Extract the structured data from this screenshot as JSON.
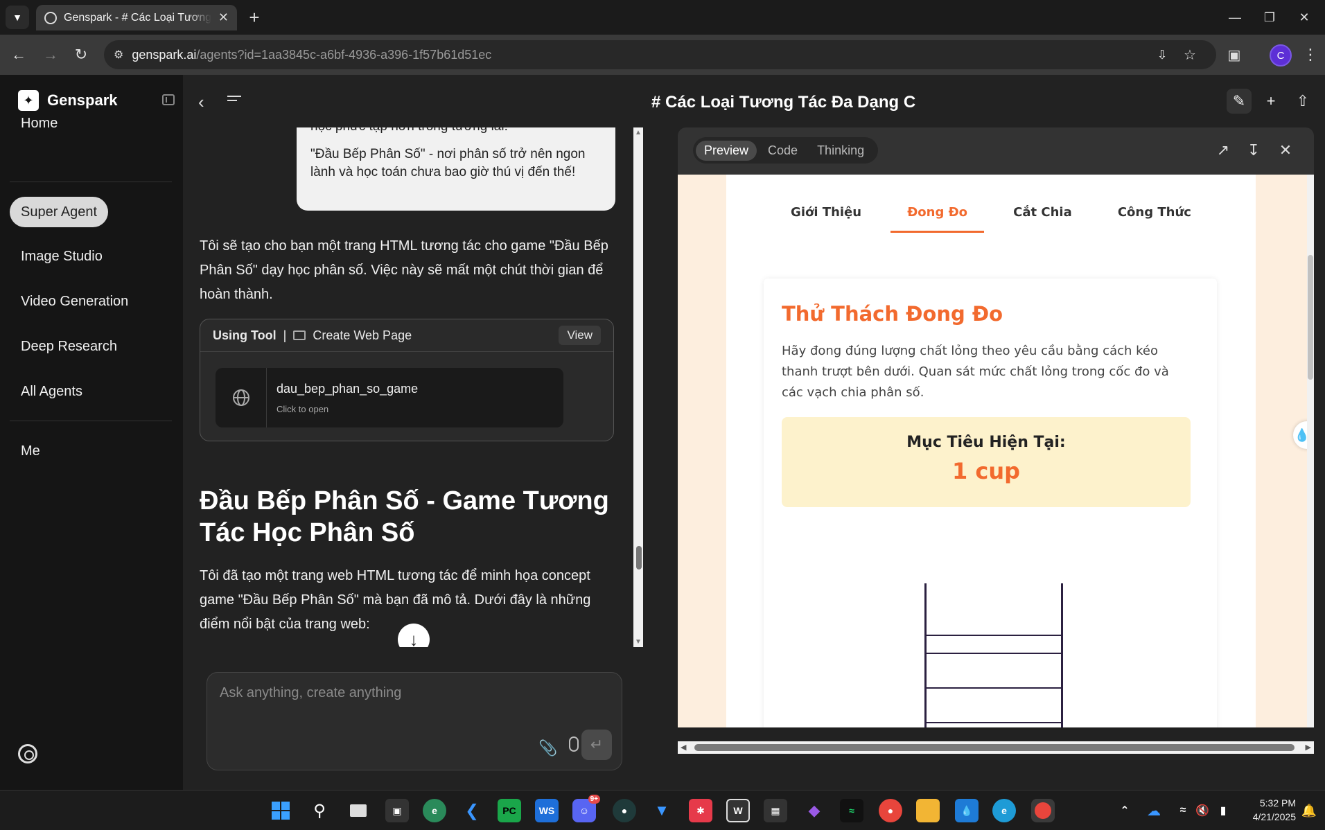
{
  "browser": {
    "tab_title": "Genspark - # Các Loại Tương Tá",
    "url_host": "genspark.ai",
    "url_path": "/agents?id=1aa3845c-a6bf-4936-a396-1f57b61d51ec",
    "profile_initial": "C"
  },
  "sidebar": {
    "brand": "Genspark",
    "items": [
      {
        "label": "Home"
      },
      {
        "label": "Super Agent"
      },
      {
        "label": "Image Studio"
      },
      {
        "label": "Video Generation"
      },
      {
        "label": "Deep Research"
      },
      {
        "label": "All Agents"
      },
      {
        "label": "Me"
      }
    ]
  },
  "chat": {
    "user_bubble": {
      "line1": "học phức tạp hơn trong tương lai.",
      "line2": "\"Đầu Bếp Phân Số\" - nơi phân số trở nên ngon lành và học toán chưa bao giờ thú vị đến thế!"
    },
    "intro": "Tôi sẽ tạo cho bạn một trang HTML tương tác cho game \"Đầu Bếp Phân Số\" dạy học phân số. Việc này sẽ mất một chút thời gian để hoàn thành.",
    "tool": {
      "using_label": "Using Tool",
      "separator": "|",
      "name": "Create Web Page",
      "view_label": "View",
      "item_name": "dau_bep_phan_so_game",
      "item_sub": "Click to open"
    },
    "answer_title": "Đầu Bếp Phân Số - Game Tương Tác Học Phân Số",
    "answer_text": "Tôi đã tạo một trang web HTML tương tác để minh họa concept game \"Đầu Bếp Phân Số\" mà bạn đã mô tả. Dưới đây là những điểm nổi bật của trang web:",
    "input_placeholder": "Ask anything, create anything"
  },
  "right": {
    "doc_title": "# Các Loại Tương Tác Đa Dạng C",
    "mode_tabs": [
      "Preview",
      "Code",
      "Thinking"
    ],
    "page": {
      "tabs": [
        "Giới Thiệu",
        "Đong Đo",
        "Cắt Chia",
        "Công Thức"
      ],
      "challenge_title": "Thử Thách Đong Đo",
      "challenge_desc": "Hãy đong đúng lượng chất lỏng theo yêu cầu bằng cách kéo thanh trượt bên dưới. Quan sát mức chất lỏng trong cốc đo và các vạch chia phân số.",
      "goal_label": "Mục Tiêu Hiện Tại:",
      "goal_value": "1 cup"
    }
  },
  "taskbar": {
    "time": "5:32 PM",
    "date": "4/21/2025",
    "badge_discord": "9+"
  },
  "colors": {
    "accent_orange": "#f26a2e",
    "goal_bg": "#fdf2cc",
    "preview_bg": "#fdeede"
  }
}
